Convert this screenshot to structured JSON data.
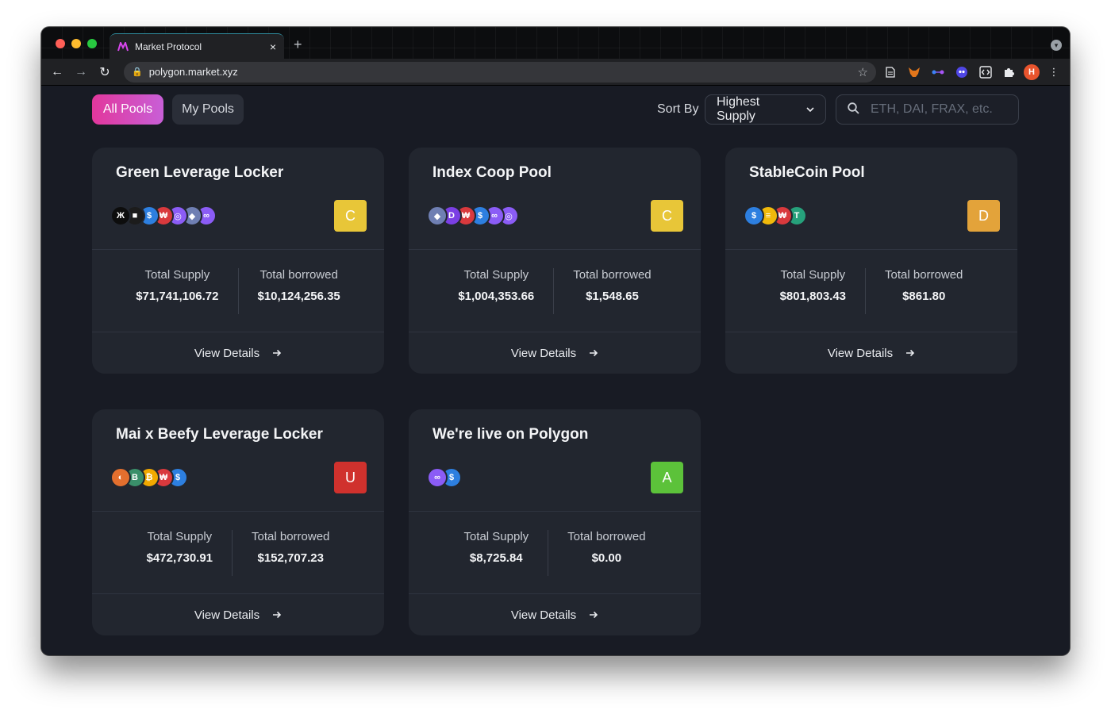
{
  "browser": {
    "tab_title": "Market Protocol",
    "tab_close": "×",
    "new_tab": "+",
    "url": "polygon.market.xyz",
    "avatar_letter": "H",
    "back": "←",
    "forward": "→",
    "reload": "↻",
    "lock": "🔒",
    "star": "☆"
  },
  "filters": {
    "all_pools": "All Pools",
    "my_pools": "My Pools",
    "sort_by_label": "Sort By",
    "sort_value": "Highest Supply",
    "search_placeholder": "ETH, DAI, FRAX, etc."
  },
  "labels": {
    "total_supply": "Total Supply",
    "total_borrowed": "Total borrowed",
    "view_details": "View Details"
  },
  "pools": [
    {
      "name": "Green Leverage Locker",
      "grade": "C",
      "grade_color": "#e8c638",
      "supply": "$71,741,106.72",
      "borrowed": "$10,124,256.35",
      "tokens": [
        {
          "c": "#0d0d0d",
          "g": "Ж"
        },
        {
          "c": "#1c1c1c",
          "g": "■"
        },
        {
          "c": "#2d7fe0",
          "g": "$"
        },
        {
          "c": "#d9393d",
          "g": "₩"
        },
        {
          "c": "#8b5cf6",
          "g": "◎"
        },
        {
          "c": "#6f7fb3",
          "g": "◆"
        },
        {
          "c": "#8b5cf6",
          "g": "∞"
        }
      ]
    },
    {
      "name": "Index Coop Pool",
      "grade": "C",
      "grade_color": "#e8c638",
      "supply": "$1,004,353.66",
      "borrowed": "$1,548.65",
      "tokens": [
        {
          "c": "#6f7fb3",
          "g": "◆"
        },
        {
          "c": "#7b3fe4",
          "g": "D"
        },
        {
          "c": "#d9393d",
          "g": "₩"
        },
        {
          "c": "#2d7fe0",
          "g": "$"
        },
        {
          "c": "#8b5cf6",
          "g": "∞"
        },
        {
          "c": "#8b5cf6",
          "g": "◎"
        }
      ]
    },
    {
      "name": "StableCoin Pool",
      "grade": "D",
      "grade_color": "#e3a33a",
      "supply": "$801,803.43",
      "borrowed": "$861.80",
      "tokens": [
        {
          "c": "#2d7fe0",
          "g": "$"
        },
        {
          "c": "#f0b90b",
          "g": "≡"
        },
        {
          "c": "#d9393d",
          "g": "₩"
        },
        {
          "c": "#26a17b",
          "g": "T"
        }
      ]
    },
    {
      "name": "Mai x Beefy Leverage Locker",
      "grade": "U",
      "grade_color": "#d0312d",
      "supply": "$472,730.91",
      "borrowed": "$152,707.23",
      "tokens": [
        {
          "c": "#e36f2e",
          "g": "◐"
        },
        {
          "c": "#3a8f6a",
          "g": "B"
        },
        {
          "c": "#f2a900",
          "g": "₿"
        },
        {
          "c": "#d9393d",
          "g": "₩"
        },
        {
          "c": "#2d7fe0",
          "g": "$"
        }
      ]
    },
    {
      "name": "We're live on Polygon",
      "grade": "A",
      "grade_color": "#5cc23a",
      "supply": "$8,725.84",
      "borrowed": "$0.00",
      "tokens": [
        {
          "c": "#8b5cf6",
          "g": "∞"
        },
        {
          "c": "#2d7fe0",
          "g": "$"
        }
      ]
    }
  ]
}
